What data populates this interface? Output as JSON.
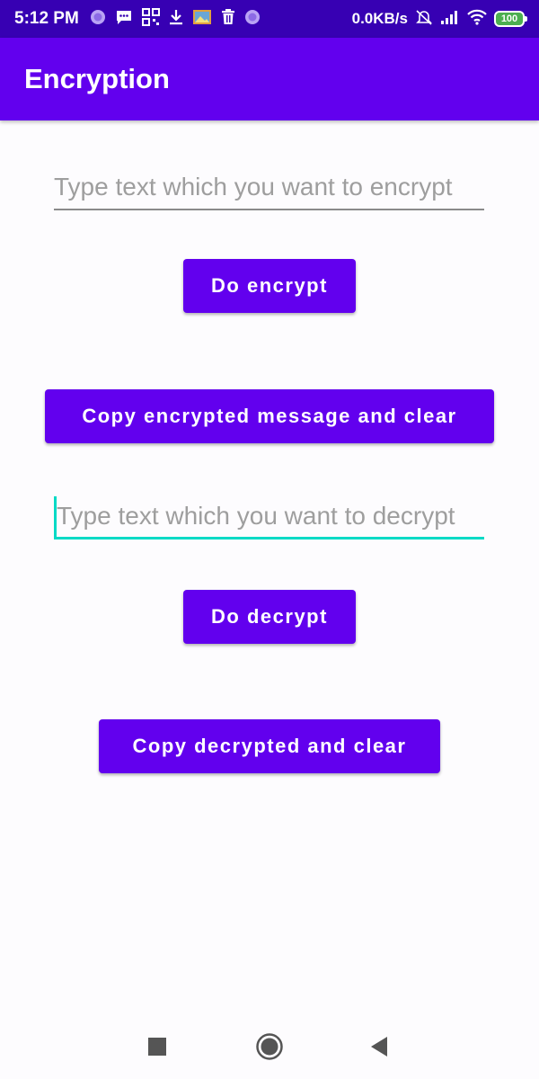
{
  "status_bar": {
    "time": "5:12 PM",
    "net_speed": "0.0KB/s",
    "battery": "100",
    "icons_left": [
      "tor-icon",
      "message-icon",
      "qr-grid-icon",
      "download-icon",
      "photo-icon",
      "trash-icon",
      "tor-icon"
    ],
    "icons_right": [
      "bell-off-icon",
      "signal-icon",
      "wifi-icon",
      "battery-icon"
    ]
  },
  "app_bar": {
    "title": "Encryption"
  },
  "encrypt": {
    "input_placeholder": "Type text which you want to encrypt",
    "input_value": "",
    "do_button_label": "Do encrypt",
    "copy_button_label": "Copy encrypted message and clear"
  },
  "decrypt": {
    "input_placeholder": "Type text which you want to decrypt",
    "input_value": "",
    "do_button_label": "Do decrypt",
    "copy_button_label": "Copy decrypted and clear"
  },
  "colors": {
    "primary": "#6200ee",
    "primary_dark": "#3700b3",
    "accent": "#03dac5",
    "background": "#fdfcfe"
  },
  "nav_bar": {
    "buttons": [
      "recents-square-icon",
      "home-circle-icon",
      "back-triangle-icon"
    ]
  }
}
